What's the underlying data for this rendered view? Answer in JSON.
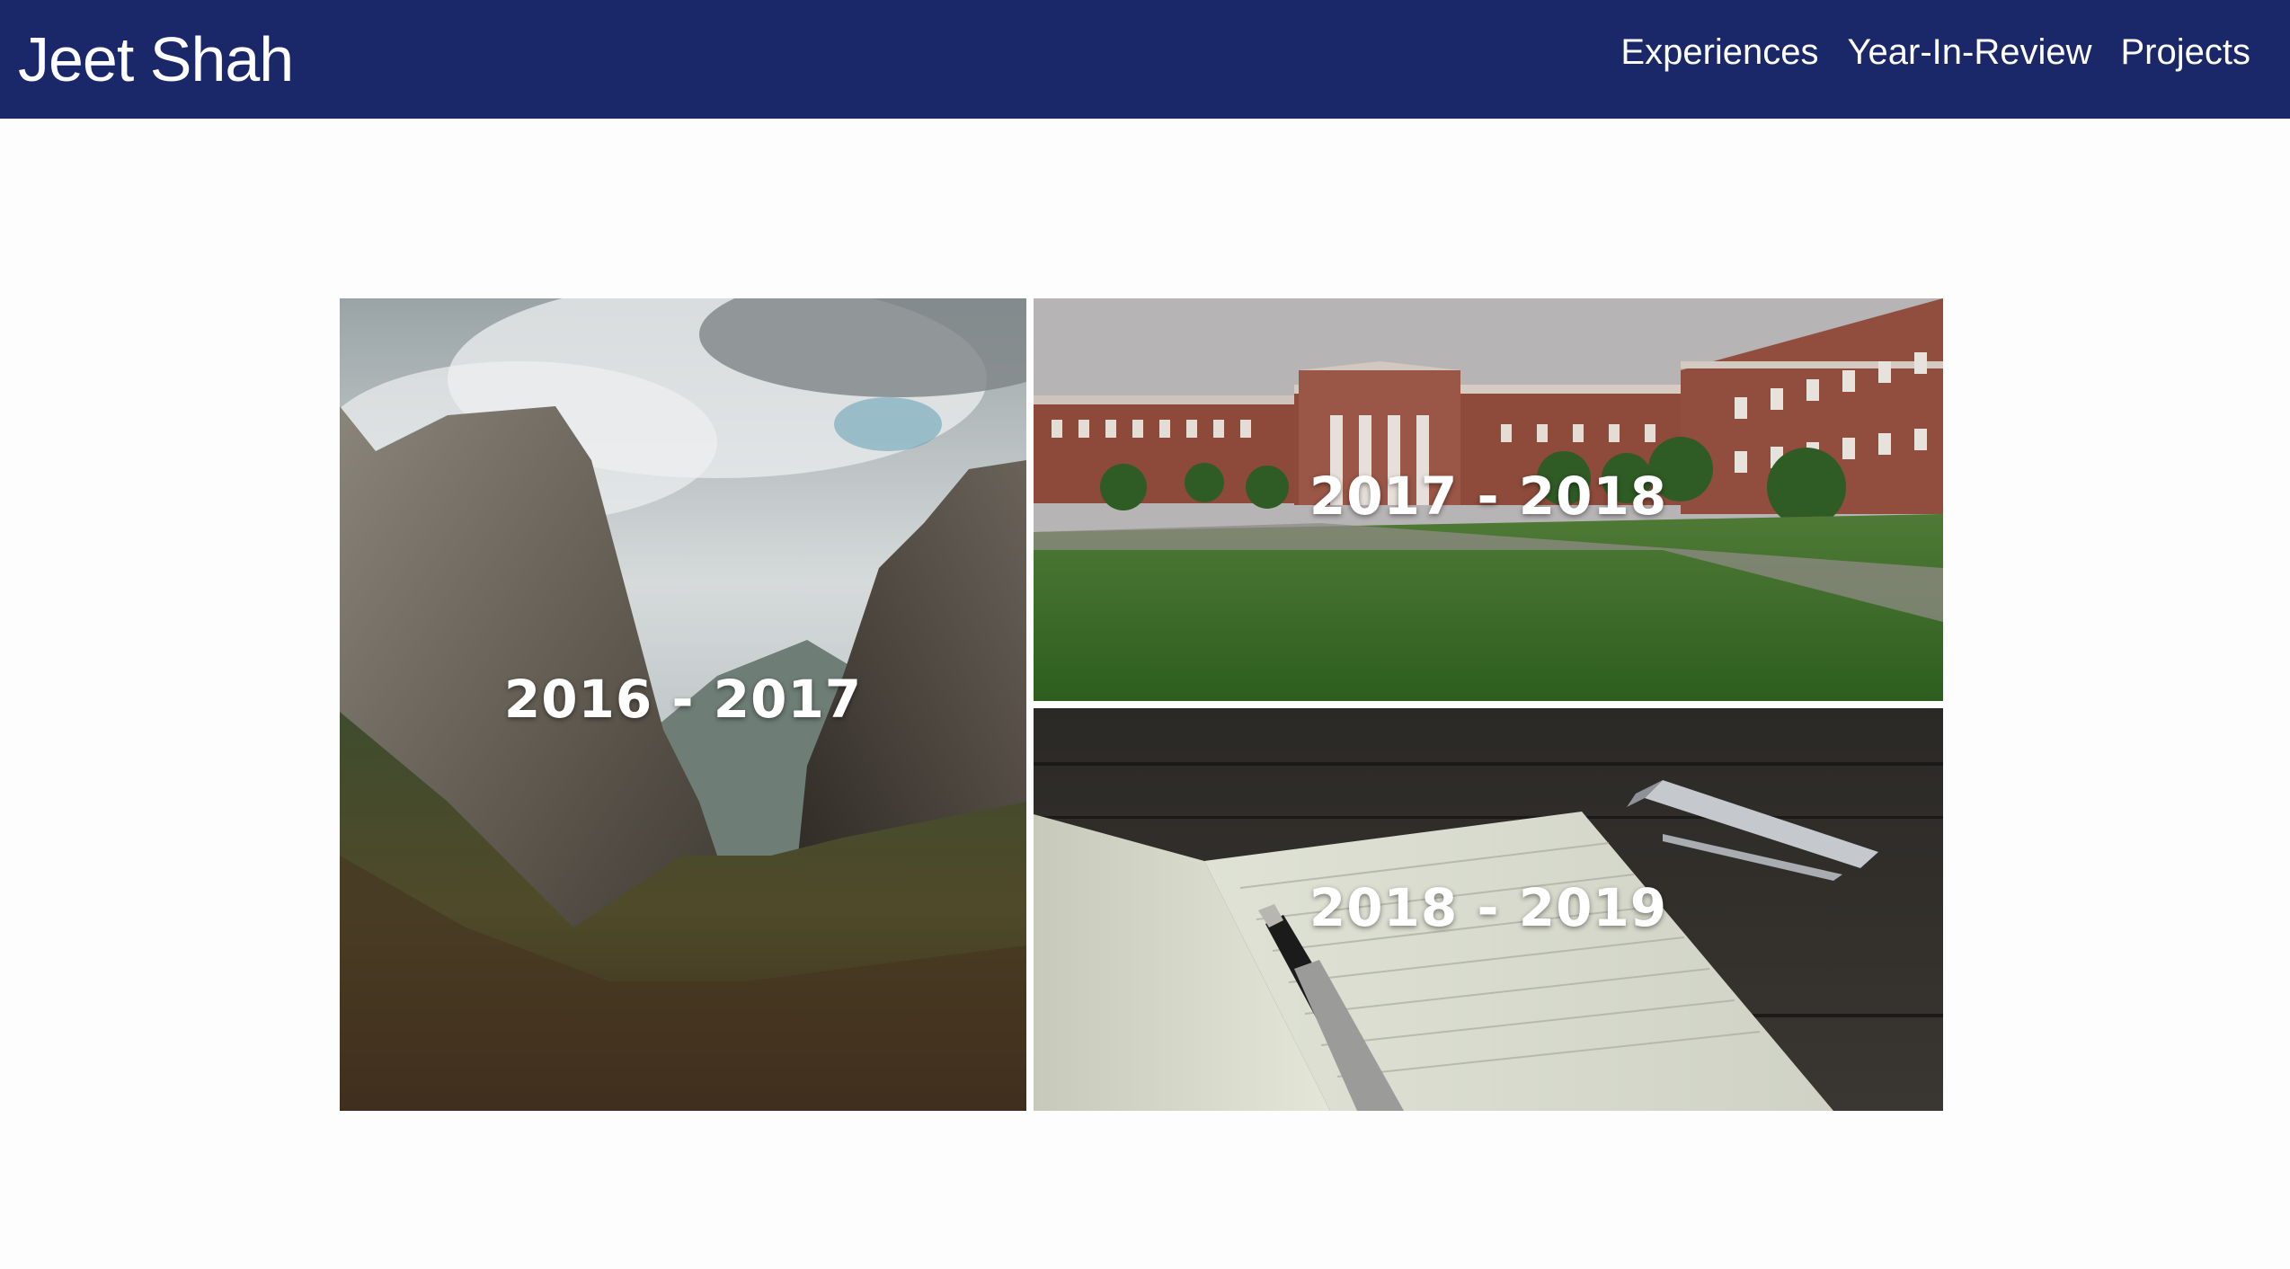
{
  "site": {
    "brand": "Jeet Shah",
    "nav": [
      "Experiences",
      "Year-In-Review",
      "Projects"
    ]
  },
  "tiles": [
    {
      "label": "2016 - 2017",
      "image": "mountain-valley-photo"
    },
    {
      "label": "2017 - 2018",
      "image": "campus-lawn-photo"
    },
    {
      "label": "2018 - 2019",
      "image": "notebook-pen-photo"
    }
  ],
  "colors": {
    "navbar": "#1a2768",
    "background": "#fdfdfe",
    "text_light": "#ffffff"
  }
}
